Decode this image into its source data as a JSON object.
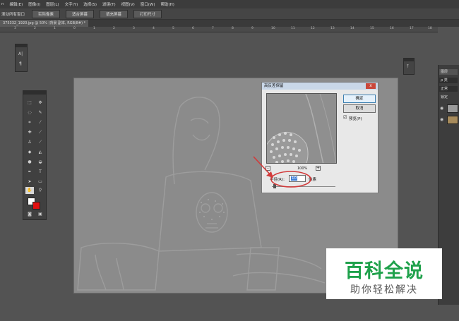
{
  "menu": [
    "n",
    "编辑(E)",
    "图像(I)",
    "图层(L)",
    "文字(Y)",
    "选择(S)",
    "滤镜(T)",
    "视图(V)",
    "窗口(W)",
    "帮助(H)"
  ],
  "options": {
    "scroll_all_label": "滚动所有窗口",
    "buttons": [
      "实际像素",
      "适合屏幕",
      "填充屏幕",
      "打印尺寸"
    ]
  },
  "doc_tab": {
    "title": "375332_1920.jpg @ 50% (背景 副本, RGB/8#) *"
  },
  "ruler_ticks": [
    "3",
    "2",
    "1",
    "0",
    "1",
    "2",
    "3",
    "4",
    "5",
    "6",
    "7",
    "8",
    "9",
    "10",
    "11",
    "12",
    "13",
    "14",
    "15",
    "16",
    "17",
    "18"
  ],
  "mini_panel_left": {
    "glyphs": [
      "A|",
      "¶"
    ]
  },
  "mini_panel_right": {
    "glyph": "⤒"
  },
  "dialog": {
    "title": "高反差保留",
    "close_label": "x",
    "ok_label": "确定",
    "cancel_label": "取消",
    "preview_label": "预览(P)",
    "preview_checked": "☑",
    "zoom_level": "100%",
    "zoom_minus": "-",
    "zoom_plus": "+",
    "radius_label": "半径(R):",
    "radius_value": "10",
    "radius_unit": "像素"
  },
  "right_dock": {
    "items": [
      "图层",
      "ρ 类",
      "正常",
      "锁定"
    ]
  },
  "watermark": {
    "title": "百科全说",
    "subtitle": "助你轻松解决"
  },
  "colors": {
    "accent_red": "#d23a3a",
    "watermark_green": "#1fa14b",
    "foreground": "#ffffff",
    "background_swatch": "#e01010"
  }
}
